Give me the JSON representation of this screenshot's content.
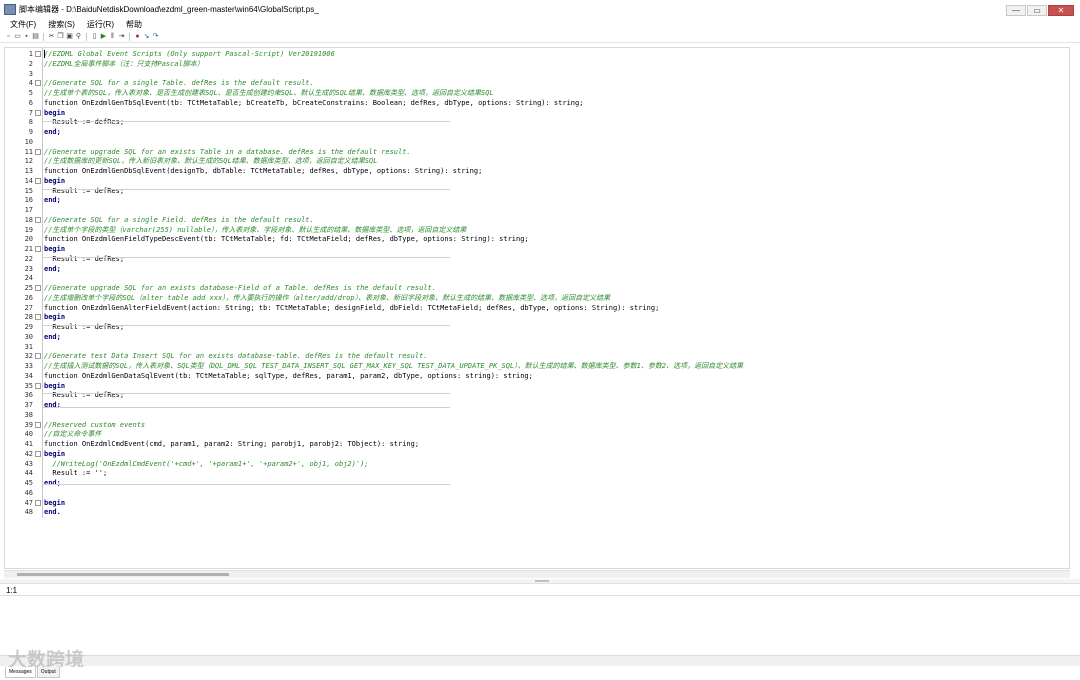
{
  "window": {
    "title": "脚本编辑器 - D:\\BaiduNetdiskDownload\\ezdml_green-master\\win64\\GlobalScript.ps_",
    "minimize_label": "—",
    "maximize_label": "▭",
    "close_label": "✕"
  },
  "menu": {
    "items": [
      {
        "label": "文件(F)"
      },
      {
        "label": "搜索(S)"
      },
      {
        "label": "运行(R)"
      },
      {
        "label": "帮助"
      }
    ]
  },
  "toolbar": {
    "buttons": [
      {
        "icon": "new-file-icon",
        "glyph": "▫"
      },
      {
        "icon": "open-folder-icon",
        "glyph": "▭"
      },
      {
        "icon": "save-icon",
        "glyph": "▪"
      },
      {
        "icon": "print-icon",
        "glyph": "▤"
      },
      {
        "icon": "cut-icon",
        "glyph": "✂"
      },
      {
        "icon": "copy-icon",
        "glyph": "❐"
      },
      {
        "icon": "paste-icon",
        "glyph": "▣"
      },
      {
        "icon": "find-icon",
        "glyph": "⚲"
      },
      {
        "icon": "compile-icon",
        "glyph": "▯"
      },
      {
        "icon": "run-icon",
        "glyph": "▶"
      },
      {
        "icon": "pause-icon",
        "glyph": "‖"
      },
      {
        "icon": "step-icon",
        "glyph": "⇥"
      },
      {
        "icon": "breakpoint-icon",
        "glyph": "●"
      },
      {
        "icon": "step-into-icon",
        "glyph": "↘"
      },
      {
        "icon": "step-over-icon",
        "glyph": "↷"
      }
    ]
  },
  "editor": {
    "lines": [
      {
        "n": "1",
        "text": "//EZDML Global Event Scripts (Only support Pascal-Script) Ver20191006",
        "type": "comment",
        "fold": "⊟"
      },
      {
        "n": "2",
        "text": "//EZDML全局事件脚本（注：只支持Pascal脚本）",
        "type": "comment",
        "fold": ""
      },
      {
        "n": "3",
        "text": "",
        "type": "code",
        "fold": ""
      },
      {
        "n": "4",
        "text": "//Generate SQL for a single Table. defRes is the default result.",
        "type": "comment",
        "fold": "⊟"
      },
      {
        "n": "5",
        "text": "//生成单个表的SQL，传入表对象、是否生成创建表SQL、是否生成创建约束SQL、默认生成的SQL结果、数据库类型、选项，返回自定义结果SQL",
        "type": "comment",
        "fold": ""
      },
      {
        "n": "6",
        "text": "function OnEzdmlGenTbSqlEvent(tb: TCtMetaTable; bCreateTb, bCreateConstrains: Boolean; defRes, dbType, options: String): string;",
        "type": "code",
        "fold": ""
      },
      {
        "n": "7",
        "text": "begin",
        "type": "kw",
        "fold": "⊟"
      },
      {
        "n": "8",
        "text": "  Result := defRes;",
        "type": "code",
        "fold": ""
      },
      {
        "n": "9",
        "text": "end;",
        "type": "kw",
        "fold": ""
      },
      {
        "n": "10",
        "text": "",
        "type": "code",
        "fold": ""
      },
      {
        "n": "11",
        "text": "//Generate upgrade SQL for an exists Table in a database. defRes is the default result.",
        "type": "comment",
        "fold": "⊟"
      },
      {
        "n": "12",
        "text": "//生成数据库的更新SQL，传入新旧表对象、默认生成的SQL结果、数据库类型、选项，返回自定义结果SQL",
        "type": "comment",
        "fold": ""
      },
      {
        "n": "13",
        "text": "function OnEzdmlGenDbSqlEvent(designTb, dbTable: TCtMetaTable; defRes, dbType, options: String): string;",
        "type": "code",
        "fold": ""
      },
      {
        "n": "14",
        "text": "begin",
        "type": "kw",
        "fold": "⊟"
      },
      {
        "n": "15",
        "text": "  Result := defRes;",
        "type": "code",
        "fold": ""
      },
      {
        "n": "16",
        "text": "end;",
        "type": "kw",
        "fold": ""
      },
      {
        "n": "17",
        "text": "",
        "type": "code",
        "fold": ""
      },
      {
        "n": "18",
        "text": "//Generate SQL for a single Field. defRes is the default result.",
        "type": "comment",
        "fold": "⊟"
      },
      {
        "n": "19",
        "text": "//生成单个字段的类型（varchar(255) nullable），传入表对象、字段对象、默认生成的结果、数据库类型、选项，返回自定义结果",
        "type": "comment",
        "fold": ""
      },
      {
        "n": "20",
        "text": "function OnEzdmlGenFieldTypeDescEvent(tb: TCtMetaTable; fd: TCtMetaField; defRes, dbType, options: String): string;",
        "type": "code",
        "fold": ""
      },
      {
        "n": "21",
        "text": "begin",
        "type": "kw",
        "fold": "⊟"
      },
      {
        "n": "22",
        "text": "  Result := defRes;",
        "type": "code",
        "fold": ""
      },
      {
        "n": "23",
        "text": "end;",
        "type": "kw",
        "fold": ""
      },
      {
        "n": "24",
        "text": "",
        "type": "code",
        "fold": ""
      },
      {
        "n": "25",
        "text": "//Generate upgrade SQL for an exists database-Field of a Table. defRes is the default result.",
        "type": "comment",
        "fold": "⊟"
      },
      {
        "n": "26",
        "text": "//生成增删改单个字段的SQL（alter table add xxx），传入要执行的操作（alter/add/drop）、表对象、新旧字段对象、默认生成的结果、数据库类型、选项，返回自定义结果",
        "type": "comment",
        "fold": ""
      },
      {
        "n": "27",
        "text": "function OnEzdmlGenAlterFieldEvent(action: String; tb: TCtMetaTable; designField, dbField: TCtMetaField; defRes, dbType, options: String): string;",
        "type": "code",
        "fold": ""
      },
      {
        "n": "28",
        "text": "begin",
        "type": "kw",
        "fold": "⊟"
      },
      {
        "n": "29",
        "text": "  Result := defRes;",
        "type": "code",
        "fold": ""
      },
      {
        "n": "30",
        "text": "end;",
        "type": "kw",
        "fold": ""
      },
      {
        "n": "31",
        "text": "",
        "type": "code",
        "fold": ""
      },
      {
        "n": "32",
        "text": "//Generate test Data Insert SQL for an exists database-table. defRes is the default result.",
        "type": "comment",
        "fold": "⊟"
      },
      {
        "n": "33",
        "text": "//生成插入测试数据的SQL，传入表对象、SQL类型（DQL_DML_SQL TEST_DATA_INSERT_SQL GET_MAX_KEY_SQL TEST_DATA_UPDATE_PK_SQL）、默认生成的结果、数据库类型、参数1、参数2、选项，返回自定义结果",
        "type": "comment",
        "fold": ""
      },
      {
        "n": "34",
        "text": "function OnEzdmlGenDataSqlEvent(tb: TCtMetaTable; sqlType, defRes, param1, param2, dbType, options: string): string;",
        "type": "code",
        "fold": ""
      },
      {
        "n": "35",
        "text": "begin",
        "type": "kw",
        "fold": "⊟"
      },
      {
        "n": "36",
        "text": "  Result := defRes;",
        "type": "code",
        "fold": ""
      },
      {
        "n": "37",
        "text": "end;",
        "type": "kw",
        "fold": ""
      },
      {
        "n": "38",
        "text": "",
        "type": "code",
        "fold": ""
      },
      {
        "n": "39",
        "text": "//Reserved custom events",
        "type": "comment",
        "fold": "⊟"
      },
      {
        "n": "40",
        "text": "//自定义命令事件",
        "type": "comment",
        "fold": ""
      },
      {
        "n": "41",
        "text": "function OnEzdmlCmdEvent(cmd, param1, param2: String; parobj1, parobj2: TObject): string;",
        "type": "code",
        "fold": ""
      },
      {
        "n": "42",
        "text": "begin",
        "type": "kw",
        "fold": "⊟"
      },
      {
        "n": "43",
        "text": "  //WriteLog('OnEzdmlCmdEvent('+cmd+', '+param1+', '+param2+', obj1, obj2)');",
        "type": "comment",
        "fold": ""
      },
      {
        "n": "44",
        "text": "  Result := '';",
        "type": "code",
        "fold": ""
      },
      {
        "n": "45",
        "text": "end;",
        "type": "kw",
        "fold": ""
      },
      {
        "n": "46",
        "text": "",
        "type": "code",
        "fold": ""
      },
      {
        "n": "47",
        "text": "begin",
        "type": "kw",
        "fold": "⊟"
      },
      {
        "n": "48",
        "text": "end.",
        "type": "kw",
        "fold": ""
      }
    ]
  },
  "status": {
    "position": "1:1"
  },
  "watermark": {
    "text": "大数跨境"
  },
  "tabs": [
    {
      "label": "Messages"
    },
    {
      "label": "Output"
    }
  ]
}
